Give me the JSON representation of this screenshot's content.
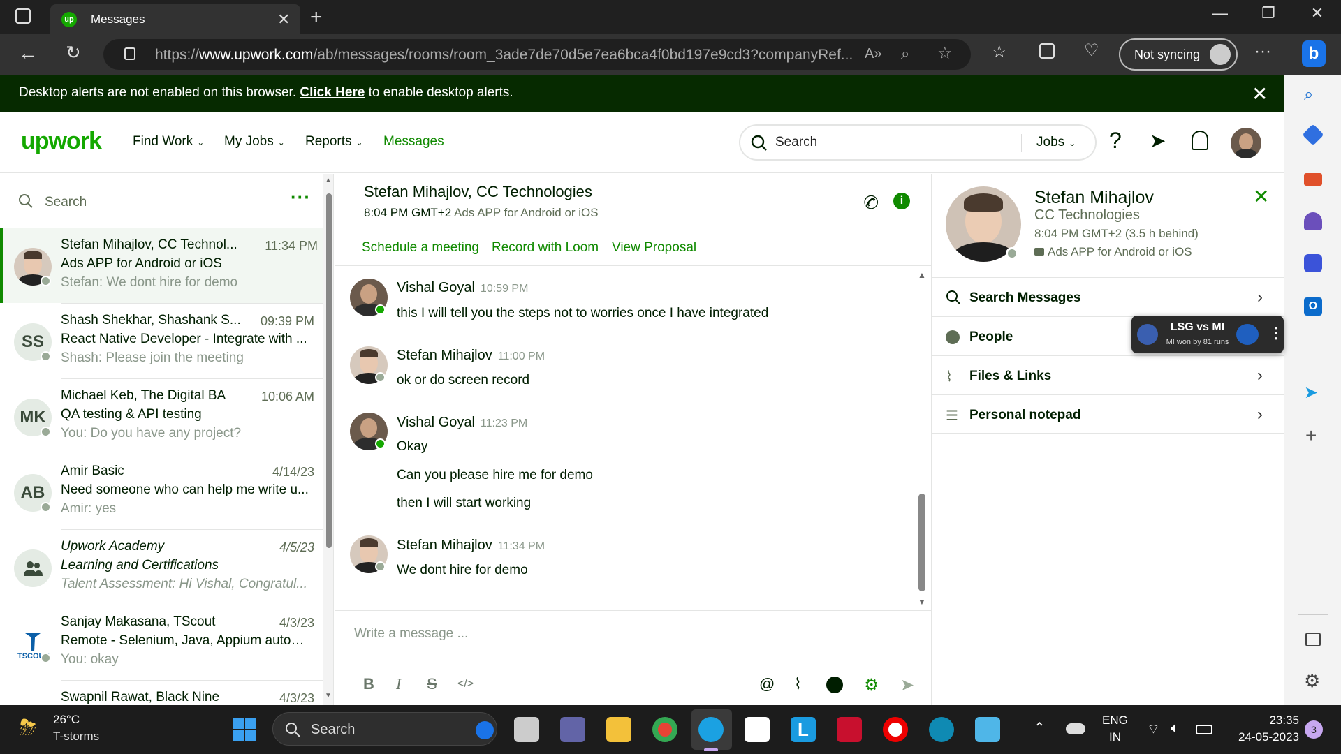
{
  "browser": {
    "tab_title": "Messages",
    "favicon_text": "up",
    "url_prefix": "https://",
    "url_host": "www.upwork.com",
    "url_path": "/ab/messages/rooms/room_3ade7de70d5e7ea6bca4f0bd197e9cd3?companyRef...",
    "sync_label": "Not syncing"
  },
  "alert": {
    "text_before": "Desktop alerts are not enabled on this browser. ",
    "link": "Click Here",
    "text_after": " to enable desktop alerts."
  },
  "nav": {
    "logo": "upwork",
    "items": [
      "Find Work",
      "My Jobs",
      "Reports",
      "Messages"
    ],
    "search_placeholder": "Search",
    "search_scope": "Jobs",
    "accent_color": "#14a800"
  },
  "conversations": {
    "search_placeholder": "Search",
    "items": [
      {
        "avatar": "",
        "name": "Stefan Mihajlov, CC Technol...",
        "time": "11:34 PM",
        "subject": "Ads APP for Android or iOS",
        "preview": "Stefan: We dont hire for demo"
      },
      {
        "avatar": "SS",
        "name": "Shash Shekhar, Shashank S...",
        "time": "09:39 PM",
        "subject": "React Native Developer - Integrate with ...",
        "preview": "Shash: Please join the meeting"
      },
      {
        "avatar": "MK",
        "name": "Michael Keb, The Digital BA",
        "time": "10:06 AM",
        "subject": "QA testing & API testing",
        "preview": "You: Do you have any project?"
      },
      {
        "avatar": "AB",
        "name": "Amir Basic",
        "time": "4/14/23",
        "subject": "Need someone who can help me write u...",
        "preview": "Amir: yes"
      },
      {
        "avatar": "",
        "name": "Upwork Academy",
        "time": "4/5/23",
        "subject": "Learning and Certifications",
        "preview": "Talent Assessment: Hi Vishal, Congratul..."
      },
      {
        "avatar": "TSCOUT",
        "name": "Sanjay Makasana, TScout",
        "time": "4/3/23",
        "subject": "Remote - Selenium, Java, Appium autom...",
        "preview": "You: okay"
      },
      {
        "avatar": "",
        "name": "Swapnil Rawat, Black Nine",
        "time": "4/3/23",
        "subject": "",
        "preview": ""
      }
    ]
  },
  "chat": {
    "title": "Stefan Mihajlov, CC Technologies",
    "local_time": "8:04 PM GMT+2",
    "job": "Ads APP for Android or iOS",
    "quick_links": [
      "Schedule a meeting",
      "Record with Loom",
      "View Proposal"
    ],
    "messages": [
      {
        "sender": "Vishal Goyal",
        "time": "10:59 PM",
        "lines": [
          "this I will tell you the steps not to worries once I have integrated"
        ]
      },
      {
        "sender": "Stefan Mihajlov",
        "time": "11:00 PM",
        "lines": [
          "ok or do screen record"
        ]
      },
      {
        "sender": "Vishal Goyal",
        "time": "11:23 PM",
        "lines": [
          "Okay",
          "Can you please hire me for demo",
          "then I will start working"
        ]
      },
      {
        "sender": "Stefan Mihajlov",
        "time": "11:34 PM",
        "lines": [
          "We dont hire for demo"
        ]
      }
    ],
    "composer_placeholder": "Write a message ..."
  },
  "profile": {
    "name": "Stefan Mihajlov",
    "company": "CC Technologies",
    "time": "8:04 PM GMT+2 (3.5 h behind)",
    "job": "Ads APP for Android or iOS",
    "sections": [
      "Search Messages",
      "People",
      "Files & Links",
      "Personal notepad"
    ]
  },
  "cricket_widget": {
    "title": "LSG vs MI",
    "subtitle": "MI won by 81 runs"
  },
  "taskbar": {
    "weather_temp": "26°C",
    "weather_desc": "T-storms",
    "search_label": "Search",
    "lang_line1": "ENG",
    "lang_line2": "IN",
    "time": "23:35",
    "date": "24-05-2023",
    "notification_count": "3"
  }
}
